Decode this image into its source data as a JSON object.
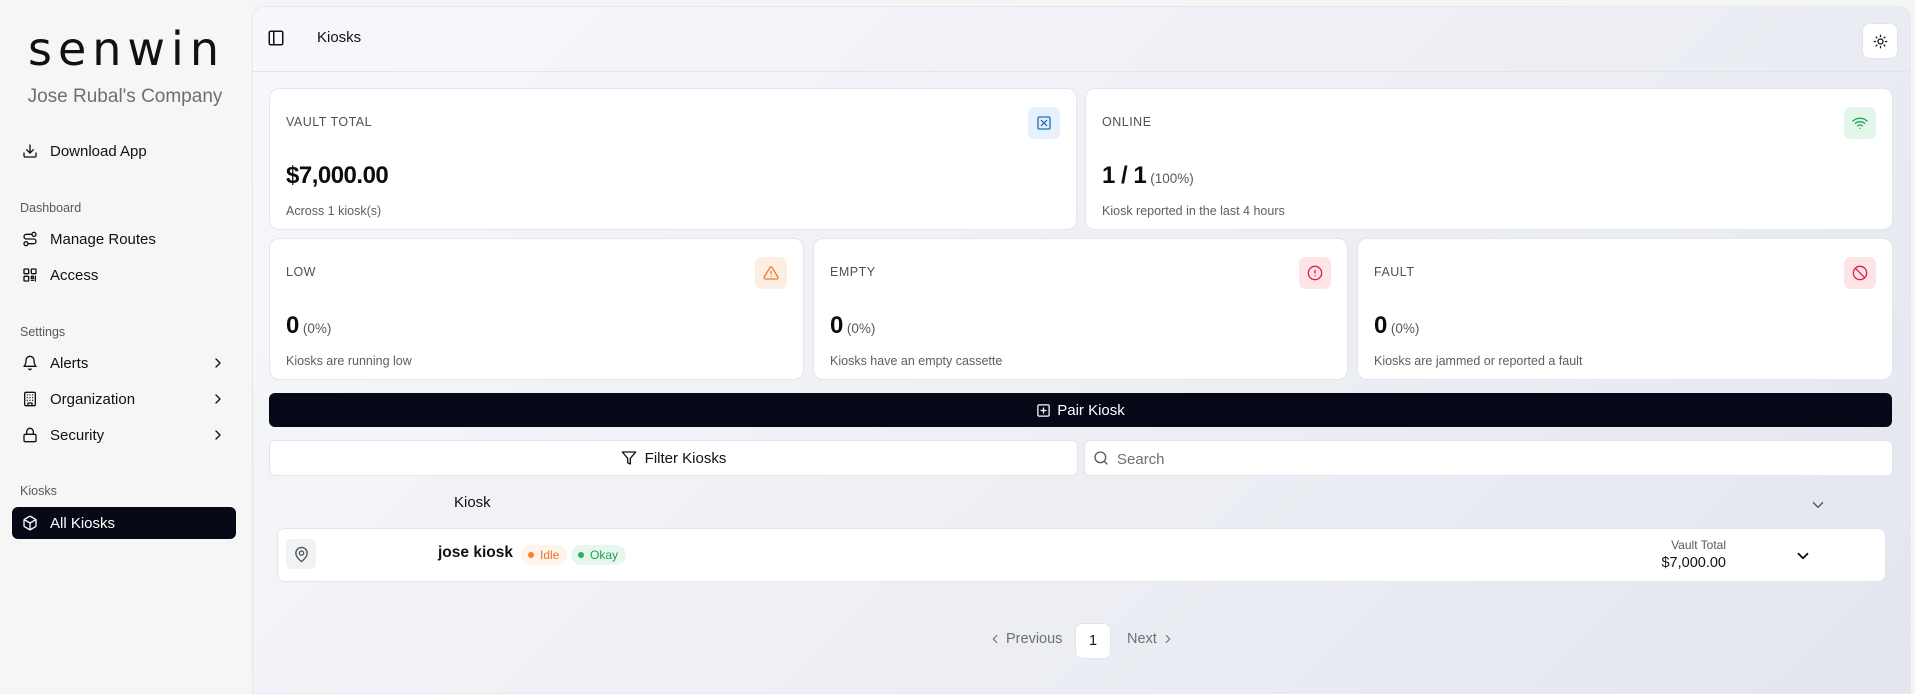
{
  "sidebar": {
    "logo": "senwin",
    "company": "Jose Rubal's Company",
    "download_label": "Download App",
    "sections": {
      "dashboard": "Dashboard",
      "settings": "Settings",
      "kiosks": "Kiosks"
    },
    "items": {
      "manage_routes": "Manage Routes",
      "access": "Access",
      "alerts": "Alerts",
      "organization": "Organization",
      "security": "Security",
      "all_kiosks": "All Kiosks"
    }
  },
  "header": {
    "title": "Kiosks"
  },
  "stats": {
    "vault": {
      "label": "VAULT TOTAL",
      "value": "$7,000.00",
      "sub": "Across 1 kiosk(s)"
    },
    "online": {
      "label": "ONLINE",
      "value": "1 / 1",
      "pct": "(100%)",
      "sub": "Kiosk reported in the last 4 hours"
    },
    "low": {
      "label": "LOW",
      "value": "0",
      "pct": "(0%)",
      "sub": "Kiosks are running low"
    },
    "empty": {
      "label": "EMPTY",
      "value": "0",
      "pct": "(0%)",
      "sub": "Kiosks have an empty cassette"
    },
    "fault": {
      "label": "FAULT",
      "value": "0",
      "pct": "(0%)",
      "sub": "Kiosks are jammed or reported a fault"
    }
  },
  "actions": {
    "pair_label": "Pair Kiosk",
    "filter_label": "Filter Kiosks",
    "search_placeholder": "Search"
  },
  "table": {
    "column_kiosk": "Kiosk",
    "rows": [
      {
        "name": "jose kiosk",
        "status_idle": "Idle",
        "status_okay": "Okay",
        "vault_label": "Vault Total",
        "vault_value": "$7,000.00"
      }
    ]
  },
  "pagination": {
    "previous": "Previous",
    "current": "1",
    "next": "Next"
  },
  "colors": {
    "accent_dark": "#050817",
    "idle": "#f5822e",
    "okay": "#22b15d",
    "fault_red": "#e11d48"
  }
}
